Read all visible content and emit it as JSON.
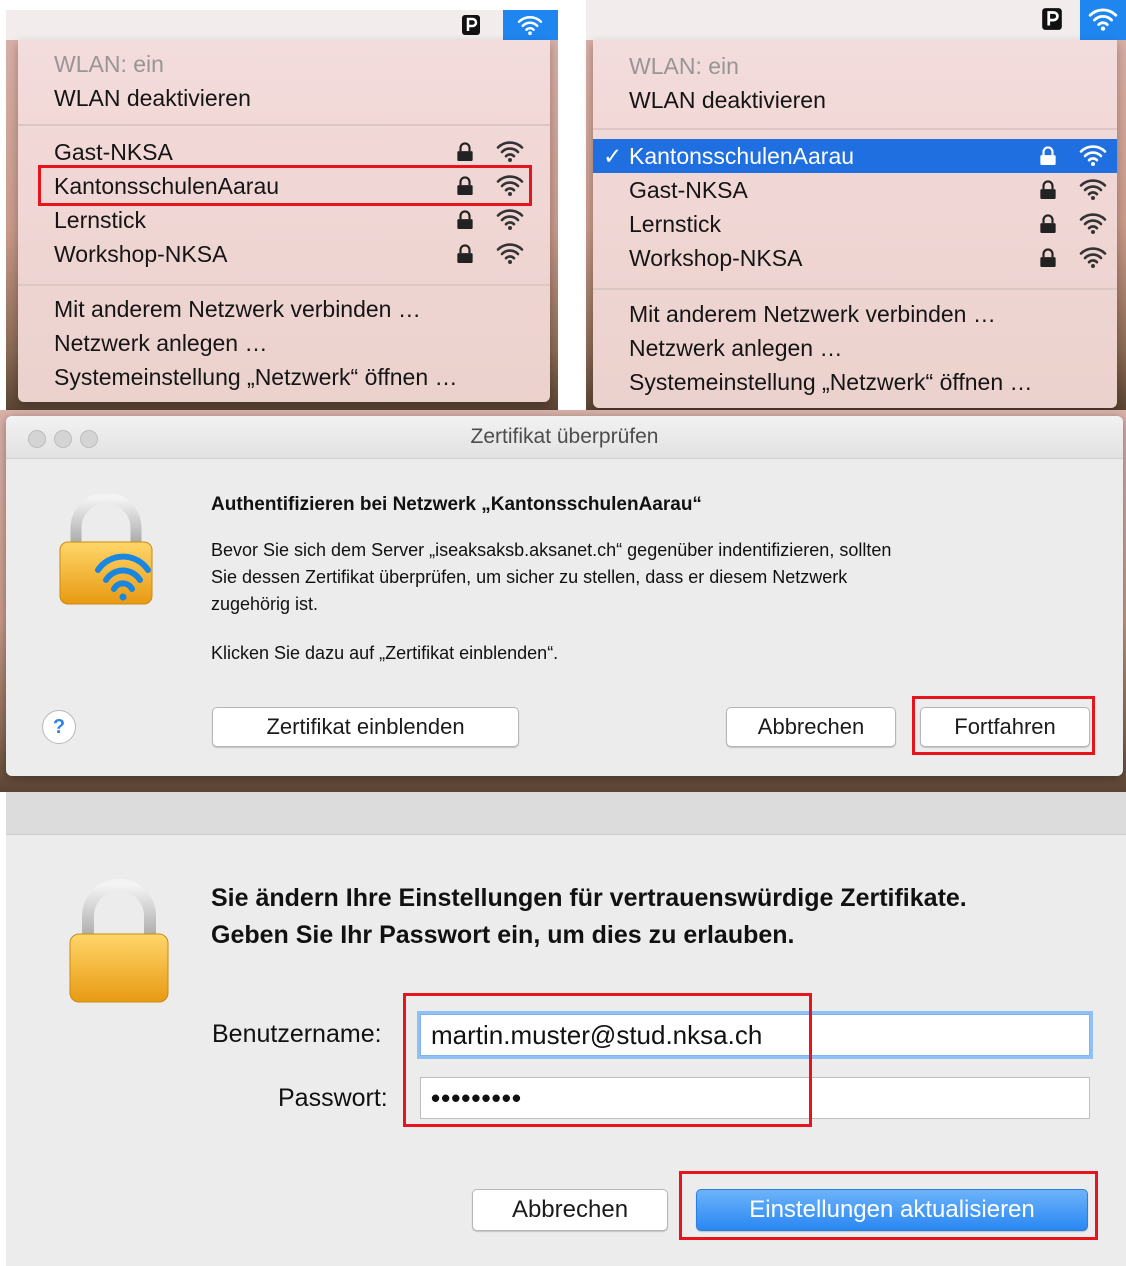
{
  "menu_left": {
    "status": "WLAN: ein",
    "toggle": "WLAN deaktivieren",
    "networks": [
      "Gast-NKSA",
      "KantonsschulenAarau",
      "Lernstick",
      "Workshop-NKSA"
    ],
    "actions": [
      "Mit anderem Netzwerk verbinden …",
      "Netzwerk anlegen …",
      "Systemeinstellung „Netzwerk“ öffnen …"
    ]
  },
  "menu_right": {
    "status": "WLAN: ein",
    "toggle": "WLAN deaktivieren",
    "check": "✓",
    "connected": "KantonsschulenAarau",
    "networks": [
      "Gast-NKSA",
      "Lernstick",
      "Workshop-NKSA"
    ],
    "actions": [
      "Mit anderem Netzwerk verbinden …",
      "Netzwerk anlegen …",
      "Systemeinstellung „Netzwerk“ öffnen …"
    ]
  },
  "cert_dialog": {
    "title": "Zertifikat überprüfen",
    "heading": "Authentifizieren bei Netzwerk „KantonsschulenAarau“",
    "body_lines": [
      "Bevor Sie sich dem Server „iseaksaksb.aksanet.ch“ gegenüber indentifizieren, sollten",
      "Sie dessen Zertifikat überprüfen, um sicher zu stellen, dass er diesem Netzwerk",
      "zugehörig ist."
    ],
    "hint": "Klicken Sie dazu auf „Zertifikat einblenden“.",
    "help": "?",
    "show_cert": "Zertifikat einblenden",
    "cancel": "Abbrechen",
    "continue": "Fortfahren"
  },
  "pw_dialog": {
    "heading_lines": [
      "Sie ändern Ihre Einstellungen für vertrauenswürdige Zertifikate.",
      "Geben Sie Ihr Passwort ein, um dies zu erlauben."
    ],
    "username_label": "Benutzername:",
    "username_value": "martin.muster@stud.nksa.ch",
    "password_label": "Passwort:",
    "password_value": "•••••••••",
    "cancel": "Abbrechen",
    "submit": "Einstellungen aktualisieren"
  },
  "colors": {
    "highlight": "#e5141d",
    "selection": "#1f6fe0",
    "accent": "#2a87f2"
  }
}
